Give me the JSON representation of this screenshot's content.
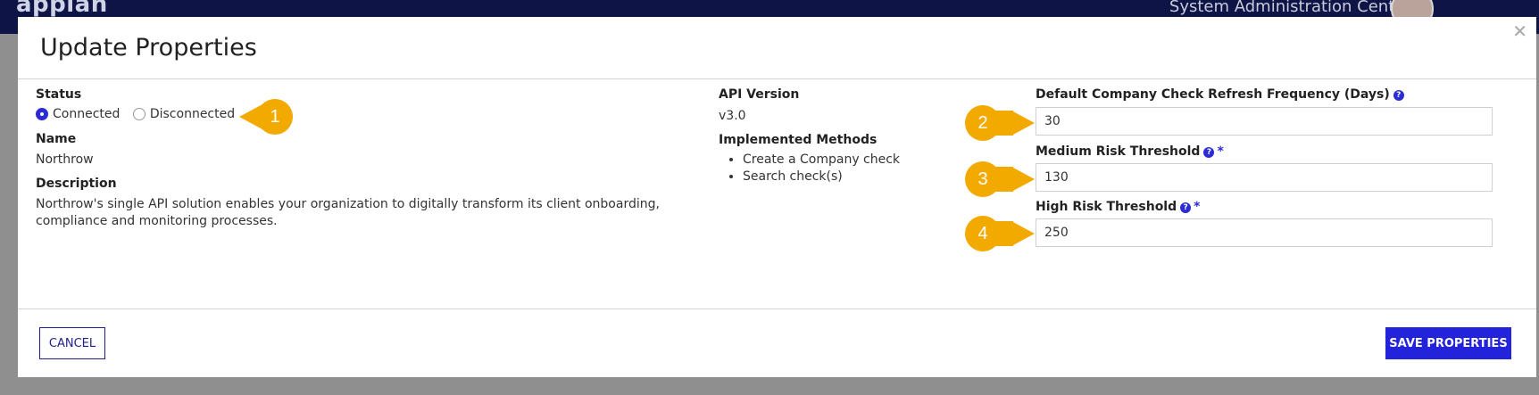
{
  "appbar": {
    "logo": "appian",
    "center_menu": "System Administration Center"
  },
  "dialog": {
    "title": "Update Properties",
    "close_glyph": "✕"
  },
  "status": {
    "label": "Status",
    "options": [
      {
        "label": "Connected",
        "selected": true
      },
      {
        "label": "Disconnected",
        "selected": false
      }
    ]
  },
  "name": {
    "label": "Name",
    "value": "Northrow"
  },
  "description": {
    "label": "Description",
    "value": "Northrow's single API solution enables your organization to digitally transform its client onboarding, compliance and monitoring processes."
  },
  "api_version": {
    "label": "API Version",
    "value": "v3.0"
  },
  "implemented_methods": {
    "label": "Implemented Methods",
    "items": [
      "Create a Company check",
      "Search check(s)"
    ]
  },
  "fields": {
    "refresh_frequency": {
      "label": "Default Company Check Refresh Frequency (Days)",
      "value": "30"
    },
    "medium_risk": {
      "label": "Medium Risk Threshold",
      "value": "130",
      "required_mark": "*"
    },
    "high_risk": {
      "label": "High Risk Threshold",
      "value": "250",
      "required_mark": "*"
    }
  },
  "annotations": [
    "1",
    "2",
    "3",
    "4"
  ],
  "footer": {
    "cancel_label": "CANCEL",
    "save_label": "SAVE PROPERTIES"
  },
  "colors": {
    "appbar": "#0f1447",
    "accent": "#2323dc",
    "marker": "#f2a900"
  }
}
